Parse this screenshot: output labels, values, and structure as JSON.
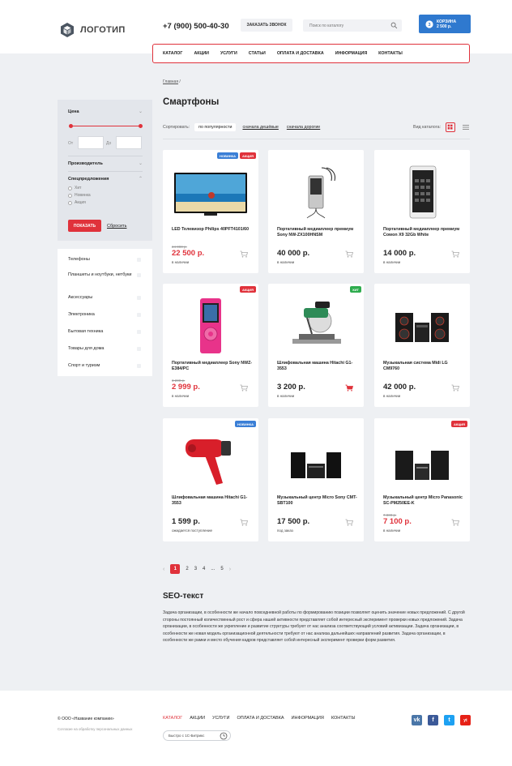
{
  "header": {
    "logo_text": "ЛОГОТИП",
    "phone": "+7 (900) 500-40-30",
    "callback_label": "ЗАКАЗАТЬ ЗВОНОК",
    "search_placeholder": "Поиск по каталогу",
    "cart_title": "КОРЗИНА",
    "cart_sum": "2 500 р.",
    "cart_count": "3"
  },
  "nav": [
    "КАТАЛОГ",
    "АКЦИИ",
    "УСЛУГИ",
    "СТАТЬИ",
    "ОПЛАТА И ДОСТАВКА",
    "ИНФОРМАЦИЯ",
    "КОНТАКТЫ"
  ],
  "breadcrumb": {
    "home": "Главная",
    "sep": "/"
  },
  "page_title": "Смартфоны",
  "sort": {
    "label": "Сортировать:",
    "options": [
      "по популярности",
      "сначала дешёвые",
      "сначала дорогие"
    ],
    "view_label": "Вид каталога:"
  },
  "filter": {
    "price_title": "Цена",
    "from_label": "От",
    "to_label": "До",
    "maker_title": "Производитель",
    "special_title": "Спецпредложения",
    "special_options": [
      "Хит",
      "Новинка",
      "Акция"
    ],
    "show_button": "ПОКАЗАТЬ",
    "reset_link": "Сбросить"
  },
  "categories": [
    "Телефоны",
    "Планшеты и ноутбуки, нетбуки",
    "Аксессуары",
    "Электроника",
    "Бытовая техника",
    "Товары для дома",
    "Спорт и туризм"
  ],
  "products": [
    {
      "name": "LED Телевизор Philips 40PFT4101/60",
      "old_price": "24 000 р.",
      "price": "22 500 р.",
      "stock": "в наличии",
      "badges": [
        "НОВИНКА",
        "АКЦИЯ"
      ],
      "price_red": true
    },
    {
      "name": "Портативный медиаплеер премиум Sony NW-ZX100HNSM",
      "old_price": "",
      "price": "40 000 р.",
      "stock": "в наличии",
      "badges": [],
      "price_red": false
    },
    {
      "name": "Портативный медиаплеер премиум Cowon X9 32Gb White",
      "old_price": "",
      "price": "14 000 р.",
      "stock": "в наличии",
      "badges": [],
      "price_red": false
    },
    {
      "name": "Портативный медиаплеер Sony NWZ-E384/PC",
      "old_price": "3 200 р.",
      "price": "2 999 р.",
      "stock": "в наличии",
      "badges": [
        "АКЦИЯ"
      ],
      "price_red": true
    },
    {
      "name": "Шлифовальная машина Hitachi G1-3553",
      "old_price": "",
      "price": "3 200 р.",
      "stock": "в наличии",
      "badges": [
        "ХИТ"
      ],
      "price_red": false
    },
    {
      "name": "Музыкальная система Midi LG CM9760",
      "old_price": "",
      "price": "42 000 р.",
      "stock": "в наличии",
      "badges": [],
      "price_red": false
    },
    {
      "name": "Шлифовальная машина Hitachi G1-3553",
      "old_price": "",
      "price": "1 599 р.",
      "stock": "ожидается поступление",
      "badges": [
        "НОВИНКА"
      ],
      "price_red": false
    },
    {
      "name": "Музыкальный центр Micro Sony CMT-SBT100",
      "old_price": "",
      "price": "17 500 р.",
      "stock": "под заказ",
      "badges": [],
      "price_red": false
    },
    {
      "name": "Музыкальный центр Micro Panasonic SC-PM250EE-K",
      "old_price": "7 800 р.",
      "price": "7 100 р.",
      "stock": "в наличии",
      "badges": [
        "АКЦИЯ"
      ],
      "price_red": true
    }
  ],
  "pagination": {
    "pages": [
      "1",
      "2",
      "3",
      "4",
      "...",
      "5"
    ],
    "prev": "‹",
    "next": "›"
  },
  "seo": {
    "title": "SEO-текст",
    "text": "Задача организации, в особенности же начало повседневной работы по формированию позиции позволяет оценить значение новых предложений. С другой стороны постоянный количественный рост и сфера нашей активности представляет собой интересный эксперимент проверки новых предложений. Задача организации, в особенности же укрепление и развитие структуры требуют от нас анализа соответствующий условий активизации. Задача организации, в особенности же новая модель организационной деятельности требуют от нас анализа дальнейших направлений развития. Задача организации, в особенности же рамки и место обучения кадров представляет собой интересный эксперимент проверки форм развития."
  },
  "footer": {
    "copyright": "© ООО «Название компании»",
    "privacy": "Согласие на обработку персональных данных",
    "nav": [
      "КАТАЛОГ",
      "АКЦИИ",
      "УСЛУГИ",
      "ОПЛАТА И ДОСТАВКА",
      "ИНФОРМАЦИЯ",
      "КОНТАКТЫ"
    ],
    "bitrix": "Быстро с 1С-Битрикс",
    "socials": [
      "vk",
      "f",
      "t",
      "yt"
    ]
  },
  "colors": {
    "accent": "#e0323b",
    "brand_blue": "#2f79cf",
    "hit_green": "#2eac4e",
    "background": "#eef0f3"
  }
}
